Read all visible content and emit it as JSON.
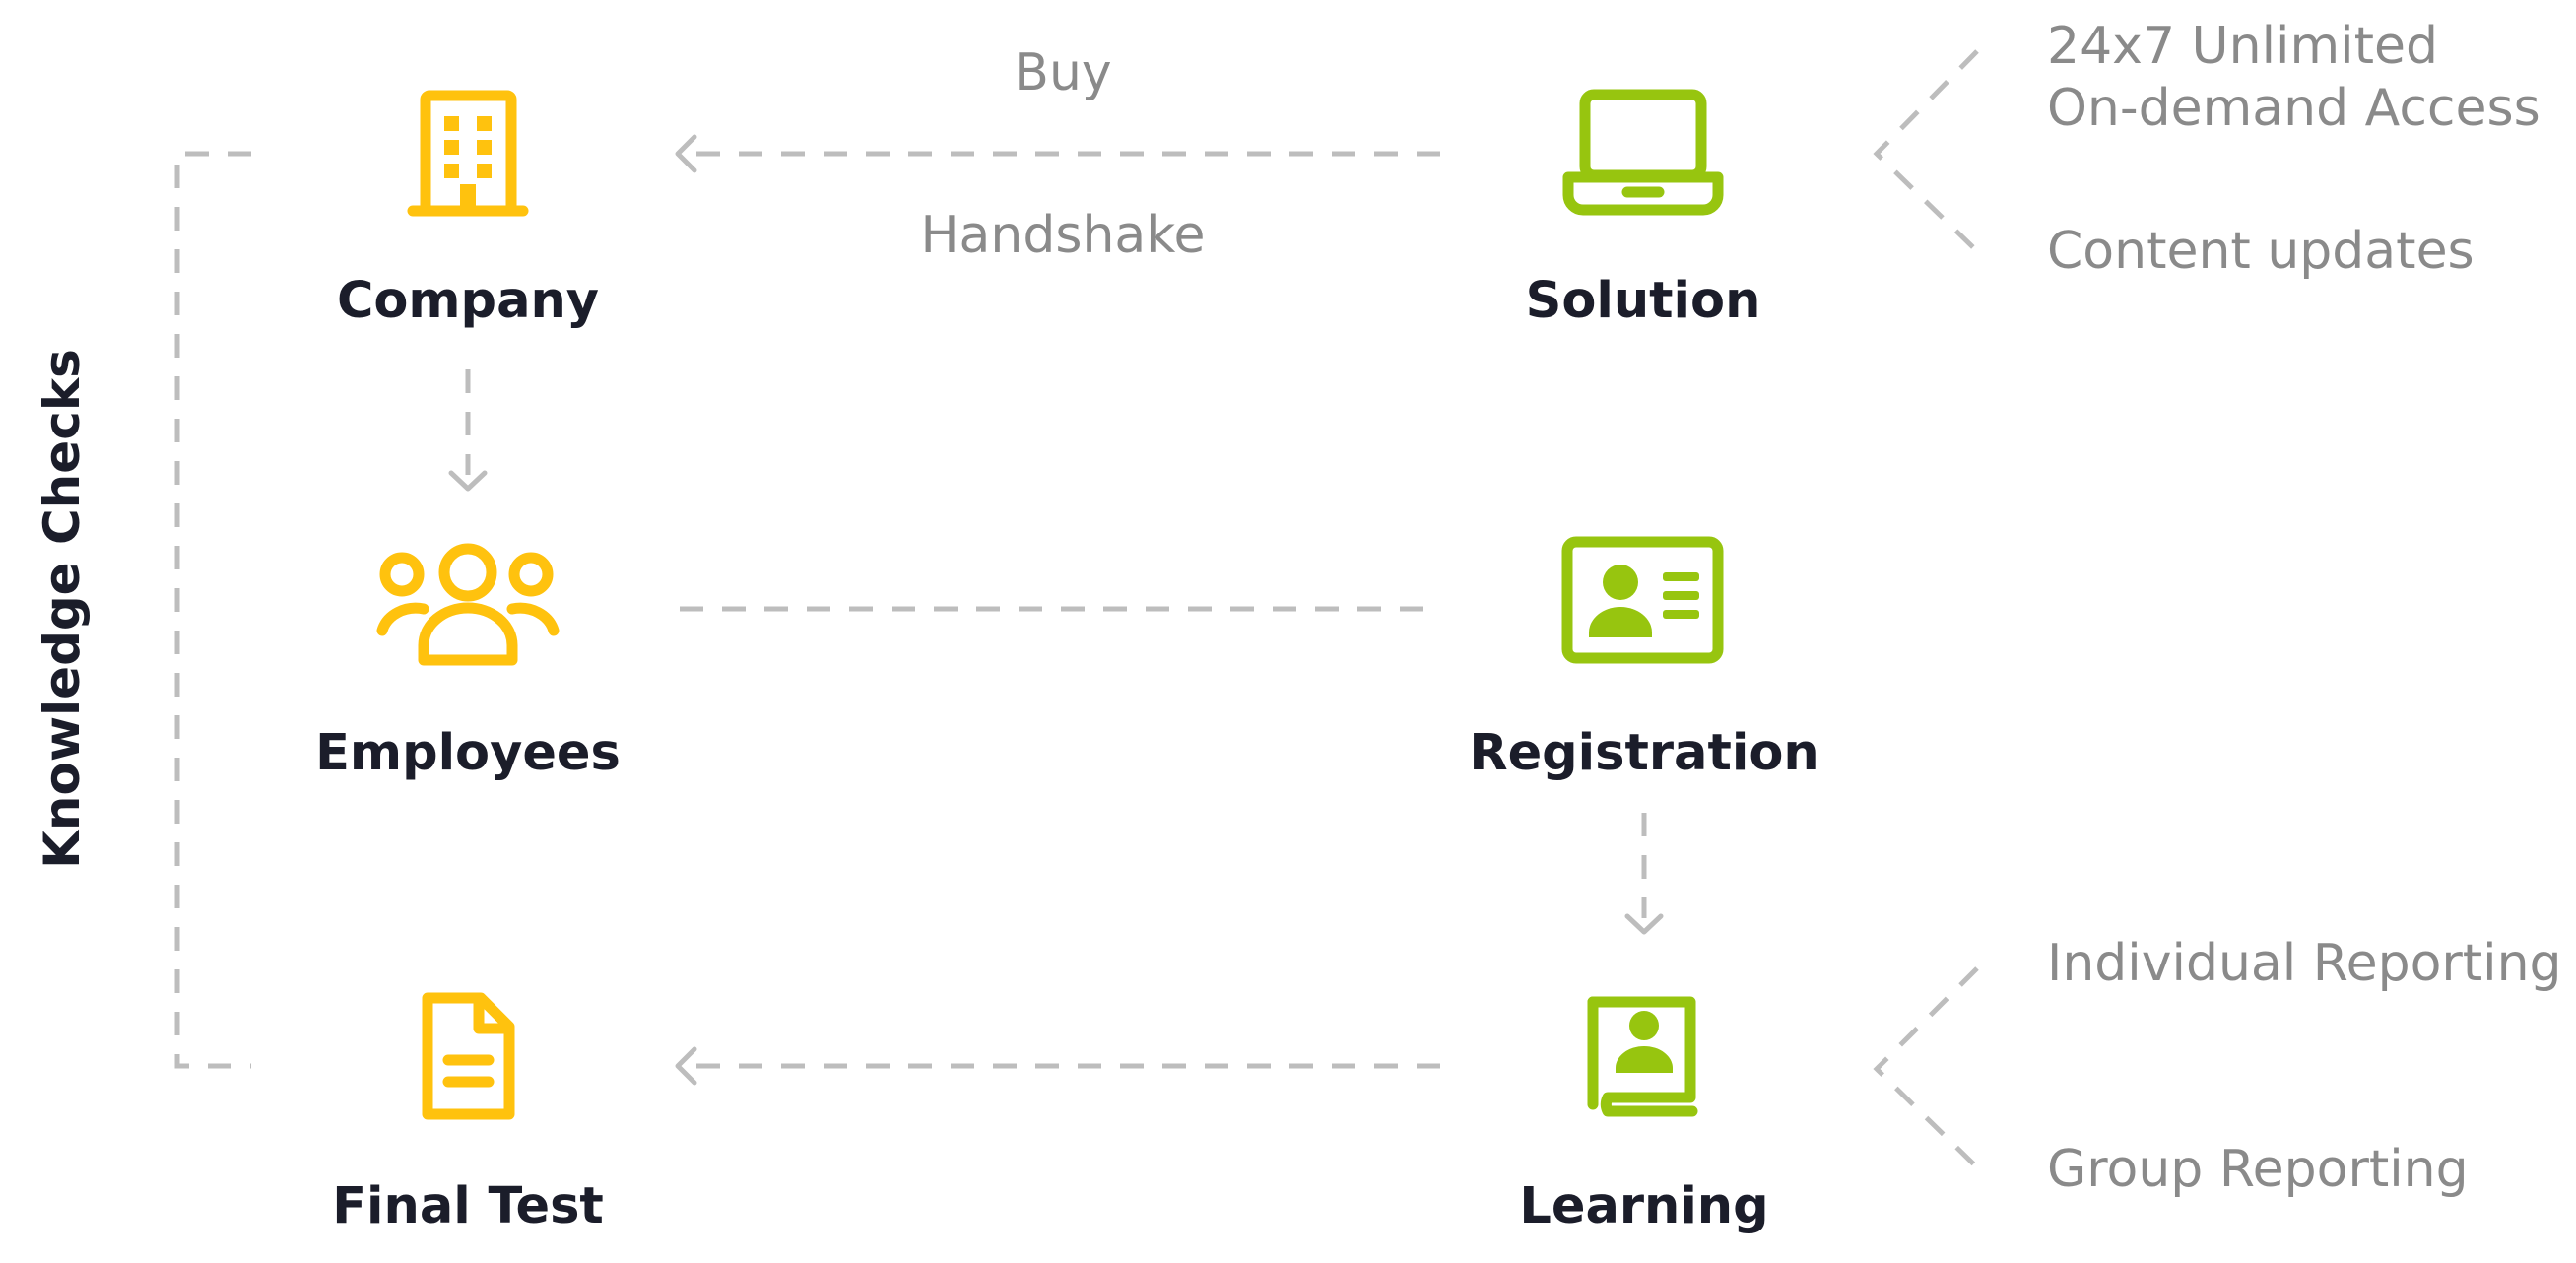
{
  "colors": {
    "company_side": "#ffc20e",
    "solution_side": "#97c50f",
    "connector": "#bdbdbd",
    "node_text": "#1b1d2a",
    "note_text": "#8a8a8a"
  },
  "loop_label": "Knowledge Checks",
  "nodes": {
    "company": {
      "label": "Company",
      "icon": "building-icon"
    },
    "employees": {
      "label": "Employees",
      "icon": "people-group-icon"
    },
    "final_test": {
      "label": "Final Test",
      "icon": "document-icon"
    },
    "solution": {
      "label": "Solution",
      "icon": "laptop-icon"
    },
    "registration": {
      "label": "Registration",
      "icon": "id-card-icon"
    },
    "learning": {
      "label": "Learning",
      "icon": "user-book-icon"
    }
  },
  "edges": {
    "buy": "Buy",
    "handshake": "Handshake"
  },
  "notes": {
    "solution": [
      "24x7 Unlimited",
      "On-demand Access",
      "Content updates"
    ],
    "learning": [
      "Individual Reporting",
      "Group Reporting"
    ]
  }
}
